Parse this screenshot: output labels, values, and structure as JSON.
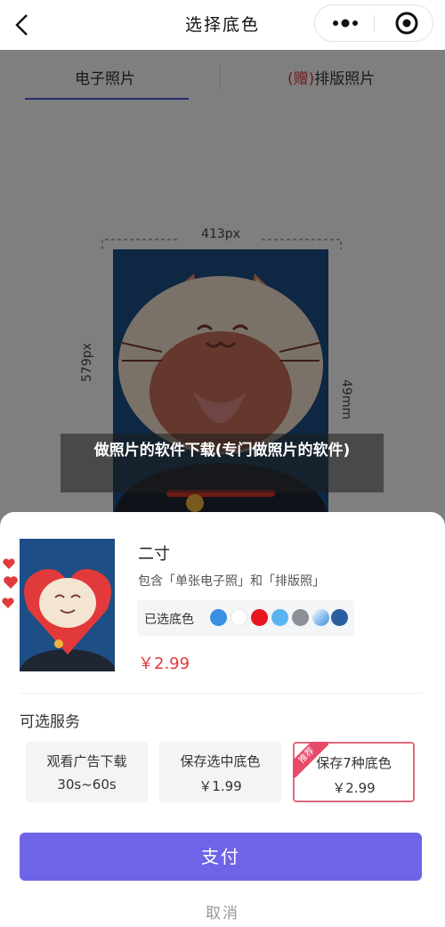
{
  "nav": {
    "title": "选择底色",
    "back_icon": "chevron-left-icon",
    "more_icon": "more-dots-icon",
    "target_icon": "target-icon"
  },
  "tabs": [
    {
      "label": "电子照片",
      "active": true
    },
    {
      "badge": "(赠)",
      "label": "排版照片",
      "active": false
    }
  ],
  "preview": {
    "width_label": "413px",
    "height_px_label": "579px",
    "height_mm_label": "49mm",
    "bg_color": "#1d4e86"
  },
  "caption": "做照片的软件下载(专门做照片的软件)",
  "sheet": {
    "size_name": "二寸",
    "size_desc": "包含「单张电子照」和「排版照」",
    "selected_color_label": "已选底色",
    "swatches": [
      "#3b8fe0",
      "#ffffff",
      "#e8141e",
      "#5ab4f0",
      "#8a8f98",
      "#7fb8ec",
      "#2a5e9e"
    ],
    "price": "￥2.99",
    "services_title": "可选服务",
    "services": [
      {
        "line1": "观看广告下载",
        "line2": "30s~60s",
        "active": false
      },
      {
        "line1": "保存选中底色",
        "line2": "￥1.99",
        "active": false
      },
      {
        "line1": "保存7种底色",
        "line2": "￥2.99",
        "active": true,
        "badge": "推荐"
      }
    ],
    "pay_label": "支付",
    "cancel_label": "取消"
  },
  "colors": {
    "accent": "#6f64e8",
    "price_red": "#e23a3a",
    "tab_underline": "#4b5bdc",
    "highlight_border": "#e06a7a"
  }
}
